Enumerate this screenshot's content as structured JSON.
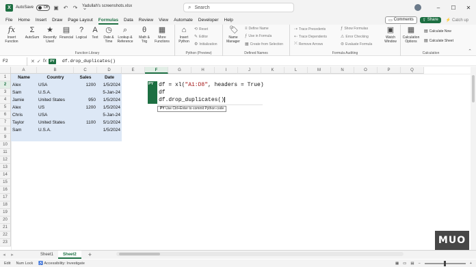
{
  "titlebar": {
    "autosave_label": "AutoSave",
    "autosave_state": "Off",
    "filename": "Yadullah's screenshots.xlsx",
    "search_placeholder": "Search"
  },
  "menu": {
    "items": [
      "File",
      "Home",
      "Insert",
      "Draw",
      "Page Layout",
      "Formulas",
      "Data",
      "Review",
      "View",
      "Automate",
      "Developer",
      "Help"
    ],
    "active": "Formulas",
    "comments_label": "Comments",
    "share_label": "Share",
    "catchup_label": "Catch up"
  },
  "ribbon": {
    "function_library": {
      "label": "Function Library",
      "insert_function": "Insert Function",
      "autosum": "AutoSum",
      "recently_used": "Recently Used",
      "financial": "Financial",
      "logical": "Logical",
      "text": "Text",
      "date_time": "Date & Time",
      "lookup_reference": "Lookup & Reference",
      "math_trig": "Math & Trig",
      "more_functions": "More Functions"
    },
    "python": {
      "label": "Python (Preview)",
      "insert_python": "Insert Python",
      "reset": "Reset",
      "editor": "Editor",
      "initialization": "Initialization"
    },
    "defined_names": {
      "label": "Defined Names",
      "name_manager": "Name Manager",
      "define_name": "Define Name",
      "use_in_formula": "Use in Formula",
      "create_from_selection": "Create from Selection"
    },
    "formula_auditing": {
      "label": "Formula Auditing",
      "trace_precedents": "Trace Precedents",
      "trace_dependents": "Trace Dependents",
      "remove_arrows": "Remove Arrows",
      "show_formulas": "Show Formulas",
      "error_checking": "Error Checking",
      "evaluate_formula": "Evaluate Formula",
      "watch_window": "Watch Window"
    },
    "calculation": {
      "label": "Calculation",
      "calculation_options": "Calculation Options",
      "calculate_now": "Calculate Now",
      "calculate_sheet": "Calculate Sheet"
    }
  },
  "formula_bar": {
    "name_box": "F2",
    "py_badge": "PY",
    "formula": "df.drop_duplicates()"
  },
  "columns": [
    "A",
    "B",
    "C",
    "D",
    "E",
    "F",
    "G",
    "H",
    "I",
    "J",
    "K",
    "L",
    "M",
    "N",
    "O",
    "P",
    "Q"
  ],
  "rows": [
    "1",
    "2",
    "3",
    "4",
    "5",
    "6",
    "7",
    "8",
    "9",
    "10",
    "11",
    "12",
    "13",
    "14",
    "15",
    "16",
    "17",
    "18",
    "19",
    "20",
    "21",
    "22",
    "23"
  ],
  "table": {
    "headers": [
      "Name",
      "Country",
      "Sales",
      "Date"
    ],
    "rows": [
      [
        "Alex",
        "USA",
        "1200",
        "1/5/2024"
      ],
      [
        "Sam",
        "U.S.A.",
        "",
        "5-Jan-24"
      ],
      [
        "Jamie",
        "United States",
        "950",
        "1/5/2024"
      ],
      [
        "Alex",
        "US",
        "1200",
        "1/5/2024"
      ],
      [
        "Chris",
        "USA",
        "",
        "5-Jan-24"
      ],
      [
        "Taylor",
        "United States",
        "1100",
        "5/1/2024"
      ],
      [
        "Sam",
        "U.S.A.",
        "",
        "1/5/2024"
      ]
    ]
  },
  "python_editor": {
    "tag": "PY",
    "line1_pre": "df = xl(",
    "line1_str": "\"A1:D8\"",
    "line1_post": ", headers = True)",
    "line2": "df",
    "line3": "df.drop_duplicates()",
    "tip_badge": "PY",
    "tip_text": "Use Ctrl+Enter to commit Python code"
  },
  "sheets": {
    "tabs": [
      "Sheet1",
      "Sheet2"
    ],
    "active": "Sheet2"
  },
  "status": {
    "edit": "Edit",
    "num_lock": "Num Lock",
    "accessibility": "Accessibility: Investigate"
  },
  "watermark": "MUO",
  "colors": {
    "accent": "#1d6f42",
    "table_fill": "#dde8f6"
  }
}
